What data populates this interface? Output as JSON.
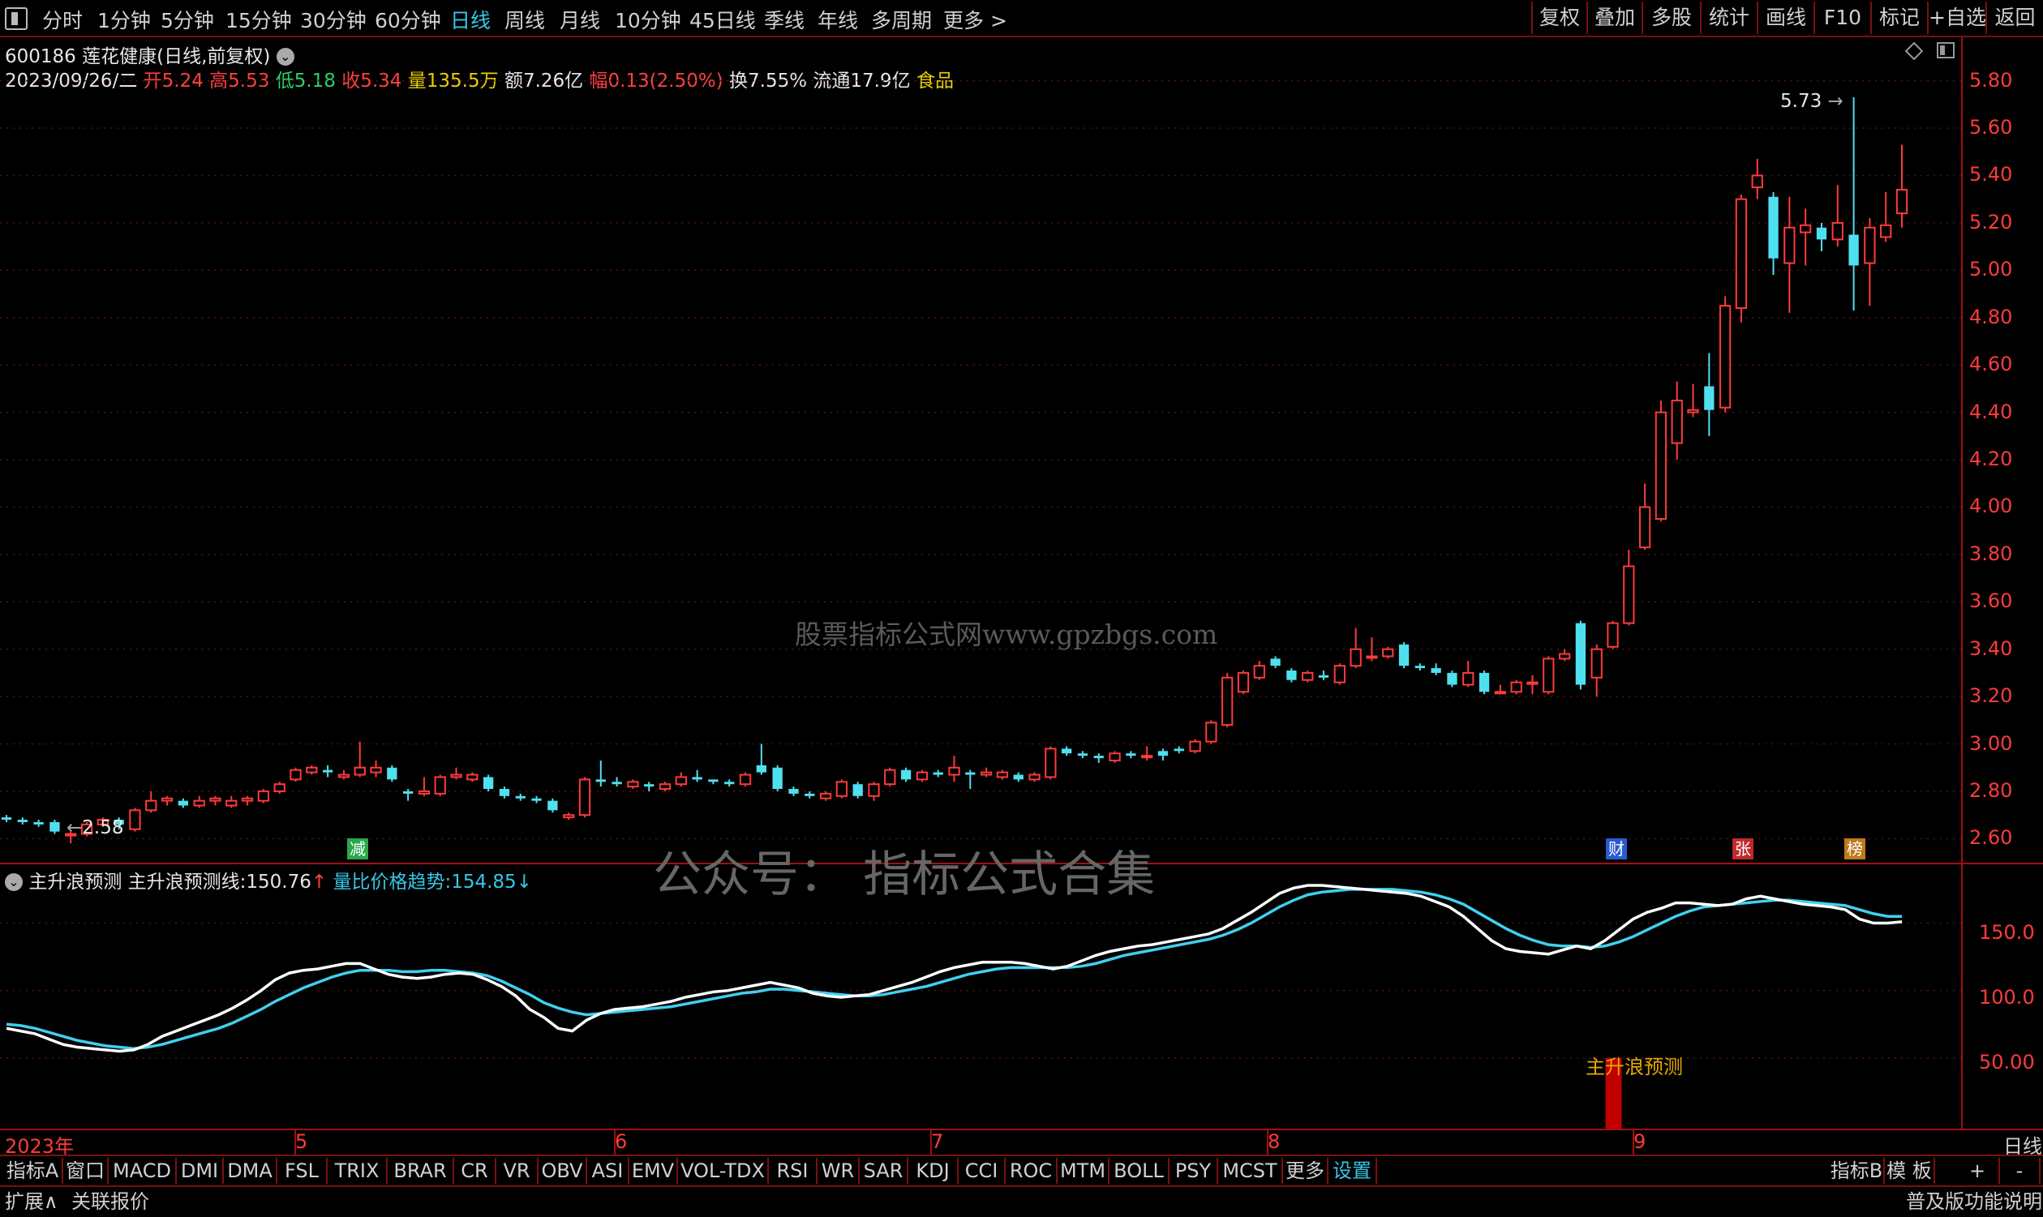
{
  "toolbar": {
    "periods": [
      "分时",
      "1分钟",
      "5分钟",
      "15分钟",
      "30分钟",
      "60分钟",
      "日线",
      "周线",
      "月线",
      "10分钟",
      "45日线",
      "季线",
      "年线",
      "多周期",
      "更多 >"
    ],
    "active_period": "日线",
    "right_tools": [
      "复权",
      "叠加",
      "多股",
      "统计",
      "画线",
      "F10",
      "标记",
      "+自选",
      "返回"
    ]
  },
  "header": {
    "code": "600186",
    "name": "莲花健康",
    "mode": "(日线,前复权)",
    "date": "2023/09/26/二",
    "open_label": "开",
    "open": "5.24",
    "high_label": "高",
    "high": "5.53",
    "low_label": "低",
    "low": "5.18",
    "close_label": "收",
    "close": "5.34",
    "vol_label": "量",
    "vol": "135.5万",
    "amount_label": "额",
    "amount": "7.26亿",
    "chg_label": "幅",
    "chg": "0.13(2.50%)",
    "turn_label": "换",
    "turn": "7.55%",
    "float_label": "流通",
    "float": "17.9亿",
    "sector": "食品"
  },
  "price_axis": [
    "5.80",
    "5.60",
    "5.40",
    "5.20",
    "5.00",
    "4.80",
    "4.60",
    "4.40",
    "4.20",
    "4.00",
    "3.80",
    "3.60",
    "3.40",
    "3.20",
    "3.00",
    "2.80",
    "2.60"
  ],
  "annotations": {
    "high_mark": "5.73",
    "low_mark": "2.58"
  },
  "badges": [
    {
      "text": "减",
      "color": "#2aa84a"
    },
    {
      "text": "财",
      "color": "#2a5ad0"
    },
    {
      "text": "张",
      "color": "#c02a2a"
    },
    {
      "text": "榜",
      "color": "#c07a1a"
    }
  ],
  "indicator": {
    "name": "主升浪预测",
    "line1_label": "主升浪预测线:",
    "line1_value": "150.76",
    "line1_arrow": "↑",
    "line2_label": "量比价格趋势:",
    "line2_value": "154.85",
    "line2_arrow": "↓",
    "signal_label": "主升浪预测",
    "axis": [
      "150.0",
      "100.0",
      "50.00"
    ]
  },
  "x_axis": {
    "labels": [
      "2023年",
      "5",
      "6",
      "7",
      "8",
      "9"
    ],
    "right": "日线"
  },
  "indicator_tabs": [
    "指标A",
    "窗口",
    "MACD",
    "DMI",
    "DMA",
    "FSL",
    "TRIX",
    "BRAR",
    "CR",
    "VR",
    "OBV",
    "ASI",
    "EMV",
    "VOL-TDX",
    "RSI",
    "WR",
    "SAR",
    "KDJ",
    "CCI",
    "ROC",
    "MTM",
    "BOLL",
    "PSY",
    "MCST",
    "更多",
    "设置"
  ],
  "indicator_tabs_right": [
    "指标B",
    "模 板",
    "+",
    "-"
  ],
  "status": {
    "left1": "扩展∧",
    "left2": "关联报价",
    "right": "普及版功能说明"
  },
  "watermarks": [
    "股票指标公式网www.gpzbgs.com",
    "公众号：  指标公式合集"
  ],
  "chart_data": {
    "type": "candlestick",
    "price_range": [
      2.55,
      5.85
    ],
    "candles": [
      {
        "o": 2.69,
        "c": 2.68,
        "h": 2.7,
        "l": 2.67
      },
      {
        "o": 2.68,
        "c": 2.67,
        "h": 2.69,
        "l": 2.66
      },
      {
        "o": 2.67,
        "c": 2.66,
        "h": 2.68,
        "l": 2.65
      },
      {
        "o": 2.67,
        "c": 2.63,
        "h": 2.68,
        "l": 2.62
      },
      {
        "o": 2.62,
        "c": 2.62,
        "h": 2.63,
        "l": 2.58
      },
      {
        "o": 2.62,
        "c": 2.66,
        "h": 2.67,
        "l": 2.61
      },
      {
        "o": 2.66,
        "c": 2.68,
        "h": 2.69,
        "l": 2.65
      },
      {
        "o": 2.68,
        "c": 2.66,
        "h": 2.69,
        "l": 2.64
      },
      {
        "o": 2.64,
        "c": 2.72,
        "h": 2.73,
        "l": 2.63
      },
      {
        "o": 2.72,
        "c": 2.76,
        "h": 2.8,
        "l": 2.71
      },
      {
        "o": 2.76,
        "c": 2.77,
        "h": 2.78,
        "l": 2.74
      },
      {
        "o": 2.76,
        "c": 2.74,
        "h": 2.77,
        "l": 2.73
      },
      {
        "o": 2.74,
        "c": 2.76,
        "h": 2.78,
        "l": 2.73
      },
      {
        "o": 2.76,
        "c": 2.77,
        "h": 2.78,
        "l": 2.74
      },
      {
        "o": 2.74,
        "c": 2.76,
        "h": 2.78,
        "l": 2.73
      },
      {
        "o": 2.76,
        "c": 2.77,
        "h": 2.78,
        "l": 2.74
      },
      {
        "o": 2.76,
        "c": 2.8,
        "h": 2.81,
        "l": 2.75
      },
      {
        "o": 2.8,
        "c": 2.83,
        "h": 2.84,
        "l": 2.79
      },
      {
        "o": 2.85,
        "c": 2.89,
        "h": 2.9,
        "l": 2.84
      },
      {
        "o": 2.88,
        "c": 2.9,
        "h": 2.91,
        "l": 2.87
      },
      {
        "o": 2.89,
        "c": 2.88,
        "h": 2.91,
        "l": 2.86
      },
      {
        "o": 2.86,
        "c": 2.87,
        "h": 2.89,
        "l": 2.85
      },
      {
        "o": 2.87,
        "c": 2.9,
        "h": 3.01,
        "l": 2.86
      },
      {
        "o": 2.88,
        "c": 2.9,
        "h": 2.93,
        "l": 2.86
      },
      {
        "o": 2.9,
        "c": 2.85,
        "h": 2.91,
        "l": 2.84
      },
      {
        "o": 2.8,
        "c": 2.79,
        "h": 2.81,
        "l": 2.76
      },
      {
        "o": 2.79,
        "c": 2.8,
        "h": 2.86,
        "l": 2.78
      },
      {
        "o": 2.79,
        "c": 2.86,
        "h": 2.87,
        "l": 2.78
      },
      {
        "o": 2.86,
        "c": 2.87,
        "h": 2.9,
        "l": 2.85
      },
      {
        "o": 2.85,
        "c": 2.87,
        "h": 2.88,
        "l": 2.84
      },
      {
        "o": 2.86,
        "c": 2.81,
        "h": 2.87,
        "l": 2.8
      },
      {
        "o": 2.81,
        "c": 2.78,
        "h": 2.82,
        "l": 2.77
      },
      {
        "o": 2.78,
        "c": 2.77,
        "h": 2.79,
        "l": 2.76
      },
      {
        "o": 2.77,
        "c": 2.76,
        "h": 2.78,
        "l": 2.75
      },
      {
        "o": 2.76,
        "c": 2.72,
        "h": 2.77,
        "l": 2.71
      },
      {
        "o": 2.69,
        "c": 2.7,
        "h": 2.71,
        "l": 2.68
      },
      {
        "o": 2.7,
        "c": 2.85,
        "h": 2.86,
        "l": 2.69
      },
      {
        "o": 2.85,
        "c": 2.84,
        "h": 2.93,
        "l": 2.82
      },
      {
        "o": 2.84,
        "c": 2.83,
        "h": 2.86,
        "l": 2.82
      },
      {
        "o": 2.82,
        "c": 2.84,
        "h": 2.85,
        "l": 2.81
      },
      {
        "o": 2.83,
        "c": 2.82,
        "h": 2.84,
        "l": 2.8
      },
      {
        "o": 2.81,
        "c": 2.83,
        "h": 2.84,
        "l": 2.8
      },
      {
        "o": 2.83,
        "c": 2.86,
        "h": 2.88,
        "l": 2.82
      },
      {
        "o": 2.86,
        "c": 2.85,
        "h": 2.89,
        "l": 2.84
      },
      {
        "o": 2.85,
        "c": 2.84,
        "h": 2.85,
        "l": 2.83
      },
      {
        "o": 2.84,
        "c": 2.83,
        "h": 2.85,
        "l": 2.82
      },
      {
        "o": 2.83,
        "c": 2.87,
        "h": 2.88,
        "l": 2.82
      },
      {
        "o": 2.91,
        "c": 2.88,
        "h": 3.0,
        "l": 2.87
      },
      {
        "o": 2.9,
        "c": 2.81,
        "h": 2.91,
        "l": 2.8
      },
      {
        "o": 2.81,
        "c": 2.79,
        "h": 2.82,
        "l": 2.78
      },
      {
        "o": 2.79,
        "c": 2.78,
        "h": 2.8,
        "l": 2.77
      },
      {
        "o": 2.77,
        "c": 2.79,
        "h": 2.8,
        "l": 2.76
      },
      {
        "o": 2.78,
        "c": 2.84,
        "h": 2.85,
        "l": 2.77
      },
      {
        "o": 2.83,
        "c": 2.78,
        "h": 2.84,
        "l": 2.77
      },
      {
        "o": 2.78,
        "c": 2.83,
        "h": 2.84,
        "l": 2.76
      },
      {
        "o": 2.83,
        "c": 2.89,
        "h": 2.9,
        "l": 2.82
      },
      {
        "o": 2.89,
        "c": 2.85,
        "h": 2.9,
        "l": 2.84
      },
      {
        "o": 2.85,
        "c": 2.88,
        "h": 2.89,
        "l": 2.84
      },
      {
        "o": 2.88,
        "c": 2.87,
        "h": 2.89,
        "l": 2.86
      },
      {
        "o": 2.87,
        "c": 2.9,
        "h": 2.95,
        "l": 2.84
      },
      {
        "o": 2.88,
        "c": 2.87,
        "h": 2.89,
        "l": 2.81
      },
      {
        "o": 2.87,
        "c": 2.88,
        "h": 2.9,
        "l": 2.86
      },
      {
        "o": 2.86,
        "c": 2.88,
        "h": 2.89,
        "l": 2.85
      },
      {
        "o": 2.87,
        "c": 2.85,
        "h": 2.88,
        "l": 2.84
      },
      {
        "o": 2.85,
        "c": 2.87,
        "h": 2.88,
        "l": 2.84
      },
      {
        "o": 2.86,
        "c": 2.98,
        "h": 2.99,
        "l": 2.85
      },
      {
        "o": 2.98,
        "c": 2.96,
        "h": 2.99,
        "l": 2.95
      },
      {
        "o": 2.96,
        "c": 2.95,
        "h": 2.97,
        "l": 2.94
      },
      {
        "o": 2.95,
        "c": 2.94,
        "h": 2.96,
        "l": 2.92
      },
      {
        "o": 2.93,
        "c": 2.96,
        "h": 2.97,
        "l": 2.92
      },
      {
        "o": 2.96,
        "c": 2.95,
        "h": 2.97,
        "l": 2.94
      },
      {
        "o": 2.95,
        "c": 2.95,
        "h": 2.99,
        "l": 2.93
      },
      {
        "o": 2.97,
        "c": 2.95,
        "h": 2.98,
        "l": 2.93
      },
      {
        "o": 2.98,
        "c": 2.97,
        "h": 2.99,
        "l": 2.96
      },
      {
        "o": 2.97,
        "c": 3.01,
        "h": 3.02,
        "l": 2.96
      },
      {
        "o": 3.01,
        "c": 3.09,
        "h": 3.1,
        "l": 3.0
      },
      {
        "o": 3.08,
        "c": 3.28,
        "h": 3.3,
        "l": 3.07
      },
      {
        "o": 3.22,
        "c": 3.3,
        "h": 3.31,
        "l": 3.21
      },
      {
        "o": 3.28,
        "c": 3.33,
        "h": 3.35,
        "l": 3.27
      },
      {
        "o": 3.36,
        "c": 3.33,
        "h": 3.37,
        "l": 3.32
      },
      {
        "o": 3.31,
        "c": 3.27,
        "h": 3.32,
        "l": 3.26
      },
      {
        "o": 3.27,
        "c": 3.3,
        "h": 3.31,
        "l": 3.26
      },
      {
        "o": 3.29,
        "c": 3.28,
        "h": 3.31,
        "l": 3.27
      },
      {
        "o": 3.26,
        "c": 3.33,
        "h": 3.34,
        "l": 3.25
      },
      {
        "o": 3.33,
        "c": 3.4,
        "h": 3.49,
        "l": 3.32
      },
      {
        "o": 3.37,
        "c": 3.37,
        "h": 3.45,
        "l": 3.35
      },
      {
        "o": 3.37,
        "c": 3.4,
        "h": 3.41,
        "l": 3.36
      },
      {
        "o": 3.42,
        "c": 3.33,
        "h": 3.43,
        "l": 3.32
      },
      {
        "o": 3.33,
        "c": 3.32,
        "h": 3.34,
        "l": 3.31
      },
      {
        "o": 3.32,
        "c": 3.3,
        "h": 3.34,
        "l": 3.29
      },
      {
        "o": 3.3,
        "c": 3.25,
        "h": 3.31,
        "l": 3.24
      },
      {
        "o": 3.25,
        "c": 3.3,
        "h": 3.35,
        "l": 3.24
      },
      {
        "o": 3.3,
        "c": 3.22,
        "h": 3.31,
        "l": 3.21
      },
      {
        "o": 3.22,
        "c": 3.22,
        "h": 3.25,
        "l": 3.21
      },
      {
        "o": 3.22,
        "c": 3.26,
        "h": 3.27,
        "l": 3.21
      },
      {
        "o": 3.26,
        "c": 3.26,
        "h": 3.29,
        "l": 3.21
      },
      {
        "o": 3.22,
        "c": 3.36,
        "h": 3.37,
        "l": 3.21
      },
      {
        "o": 3.36,
        "c": 3.38,
        "h": 3.4,
        "l": 3.35
      },
      {
        "o": 3.51,
        "c": 3.25,
        "h": 3.52,
        "l": 3.23
      },
      {
        "o": 3.28,
        "c": 3.4,
        "h": 3.42,
        "l": 3.2
      },
      {
        "o": 3.41,
        "c": 3.51,
        "h": 3.52,
        "l": 3.4
      },
      {
        "o": 3.51,
        "c": 3.75,
        "h": 3.82,
        "l": 3.5
      },
      {
        "o": 3.83,
        "c": 4.0,
        "h": 4.1,
        "l": 3.82
      },
      {
        "o": 3.95,
        "c": 4.4,
        "h": 4.45,
        "l": 3.94
      },
      {
        "o": 4.27,
        "c": 4.45,
        "h": 4.53,
        "l": 4.2
      },
      {
        "o": 4.4,
        "c": 4.41,
        "h": 4.52,
        "l": 4.38
      },
      {
        "o": 4.51,
        "c": 4.41,
        "h": 4.65,
        "l": 4.3
      },
      {
        "o": 4.42,
        "c": 4.85,
        "h": 4.89,
        "l": 4.4
      },
      {
        "o": 4.84,
        "c": 5.3,
        "h": 5.32,
        "l": 4.78
      },
      {
        "o": 5.35,
        "c": 5.4,
        "h": 5.47,
        "l": 5.3
      },
      {
        "o": 5.31,
        "c": 5.05,
        "h": 5.33,
        "l": 4.98
      },
      {
        "o": 5.03,
        "c": 5.18,
        "h": 5.31,
        "l": 4.82
      },
      {
        "o": 5.16,
        "c": 5.19,
        "h": 5.26,
        "l": 5.02
      },
      {
        "o": 5.18,
        "c": 5.13,
        "h": 5.2,
        "l": 5.08
      },
      {
        "o": 5.13,
        "c": 5.2,
        "h": 5.36,
        "l": 5.1
      },
      {
        "o": 5.15,
        "c": 5.02,
        "h": 5.73,
        "l": 4.83
      },
      {
        "o": 5.03,
        "c": 5.18,
        "h": 5.22,
        "l": 4.85
      },
      {
        "o": 5.14,
        "c": 5.19,
        "h": 5.33,
        "l": 5.12
      },
      {
        "o": 5.24,
        "c": 5.34,
        "h": 5.53,
        "l": 5.18
      }
    ],
    "indicator_range": [
      0,
      190
    ],
    "line1": [
      72,
      70,
      68,
      64,
      60,
      58,
      57,
      56,
      55,
      56,
      60,
      66,
      70,
      74,
      78,
      82,
      87,
      93,
      100,
      108,
      113,
      115,
      116,
      118,
      120,
      120,
      116,
      112,
      110,
      109,
      110,
      112,
      113,
      112,
      108,
      103,
      96,
      86,
      80,
      72,
      70,
      78,
      83,
      86,
      87,
      88,
      90,
      92,
      95,
      97,
      99,
      100,
      102,
      104,
      106,
      104,
      102,
      98,
      96,
      95,
      96,
      97,
      100,
      103,
      106,
      110,
      114,
      117,
      119,
      121,
      121,
      121,
      120,
      118,
      116,
      118,
      122,
      126,
      129,
      131,
      133,
      134,
      136,
      138,
      140,
      142,
      146,
      152,
      158,
      165,
      172,
      176,
      178,
      178,
      177,
      176,
      175,
      174,
      173,
      172,
      170,
      166,
      162,
      155,
      146,
      137,
      131,
      129,
      128,
      127,
      130,
      133,
      131,
      137,
      145,
      153,
      158,
      161,
      165,
      165,
      164,
      163,
      164,
      168,
      170,
      168,
      166,
      164,
      163,
      162,
      160,
      153,
      150,
      150,
      151
    ],
    "line2": [
      75,
      74,
      72,
      69,
      66,
      63,
      61,
      59,
      58,
      57,
      58,
      60,
      63,
      66,
      69,
      72,
      76,
      81,
      86,
      92,
      97,
      102,
      106,
      110,
      113,
      115,
      115,
      115,
      114,
      114,
      115,
      115,
      114,
      113,
      111,
      107,
      102,
      97,
      91,
      87,
      84,
      82,
      83,
      84,
      85,
      86,
      87,
      88,
      90,
      92,
      94,
      96,
      98,
      99,
      101,
      101,
      100,
      99,
      98,
      97,
      96,
      96,
      97,
      99,
      101,
      103,
      106,
      109,
      112,
      114,
      116,
      117,
      117,
      117,
      117,
      117,
      118,
      120,
      123,
      126,
      128,
      130,
      132,
      134,
      136,
      138,
      141,
      145,
      150,
      156,
      162,
      167,
      171,
      173,
      174,
      175,
      175,
      175,
      175,
      174,
      173,
      171,
      168,
      164,
      158,
      152,
      146,
      141,
      137,
      134,
      133,
      133,
      132,
      133,
      136,
      140,
      145,
      150,
      155,
      159,
      162,
      163,
      164,
      165,
      166,
      167,
      167,
      166,
      165,
      164,
      163,
      160,
      157,
      155,
      155
    ],
    "signal_index": 100,
    "signal_height": 50
  }
}
